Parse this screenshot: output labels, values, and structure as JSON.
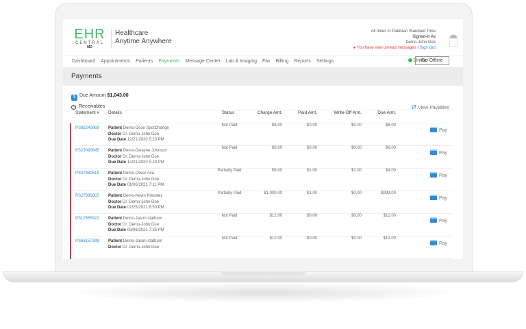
{
  "brand": {
    "logo_main": "EHR",
    "logo_sub": "CENTRAL",
    "logo_md": "MD",
    "tagline1": "Healthcare",
    "tagline2": "Anytime Anywhere"
  },
  "user": {
    "timezone": "All times in Pakistan Standard Time",
    "signed_in": "Signed-in As",
    "name": "Demo-John Doe",
    "unread": "You have new unread messages",
    "sign_out": "Sign Out"
  },
  "nav": [
    "Dashboard",
    "Appointments",
    "Patients",
    "Payments",
    "Message Center",
    "Lab & Imaging",
    "Fax",
    "Billing",
    "Reports",
    "Settings"
  ],
  "status": {
    "online": "Online",
    "go_offline": "Go Offline"
  },
  "page_title": "Payments",
  "due": {
    "label": "Due Amount",
    "value": "$1,043.00"
  },
  "receivables": "Receivables",
  "view_payables": "View Payables",
  "columns": [
    "Statement #",
    "Details",
    "Status",
    "Charge Amt.",
    "Paid Amt.",
    "Write-Off Amt.",
    "Due Amt."
  ],
  "labels": {
    "patient": "Patient",
    "doctor": "Doctor",
    "due_date": "Due Date",
    "pay": "Pay"
  },
  "rows": [
    {
      "id": "PS85240969",
      "patient": "Demo-Dose SpotChange",
      "doctor": "Dr. Demo-John Doe",
      "due_date": "12/21/2020 5:23 PM",
      "status": "Not Paid",
      "charge": "$6.00",
      "paid": "$0.00",
      "writeoff": "$0.00",
      "due": "$6.00"
    },
    {
      "id": "PS23090645",
      "patient": "Demo-Dwayne Johnson",
      "doctor": "Dr. Demo-John Doe",
      "due_date": "12/21/2020 5:24 PM",
      "status": "Not Paid",
      "charge": "$6.00",
      "paid": "$0.00",
      "writeoff": "$0.00",
      "due": "$6.00"
    },
    {
      "id": "PS37880518",
      "patient": "Demo-Oliver Ava",
      "doctor": "Dr. Demo-John Doe",
      "due_date": "01/06/2021 7:11 PM",
      "status": "Partially Paid",
      "charge": "$6.00",
      "paid": "$1.00",
      "writeoff": "$1.00",
      "due": "$4.00"
    },
    {
      "id": "PS27095007",
      "patient": "Demo-Kevin Pressley",
      "doctor": "Dr. Demo-John Doe",
      "due_date": "02/25/2021 6:50 PM",
      "status": "Partially Paid",
      "charge": "$1,000.00",
      "paid": "$1.00",
      "writeoff": "$0.00",
      "due": "$999.00"
    },
    {
      "id": "PS12585822",
      "patient": "Demo-Jason statham",
      "doctor": "Dr. Demo-John Doe",
      "due_date": "09/06/2021 7:35 PM",
      "status": "Not Paid",
      "charge": "$12.00",
      "paid": "$0.00",
      "writeoff": "$0.00",
      "due": "$12.00"
    },
    {
      "id": "PS66157399",
      "patient": "Demo-Jason statham",
      "doctor": "Dr. Demo-John Doe",
      "due_date": "",
      "status": "Not Paid",
      "charge": "$12.00",
      "paid": "$0.00",
      "writeoff": "$0.00",
      "due": "$12.00"
    }
  ]
}
